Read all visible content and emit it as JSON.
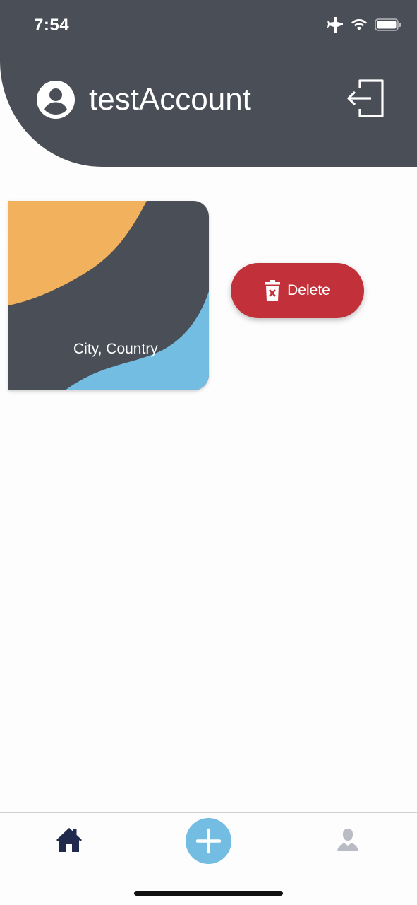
{
  "status_bar": {
    "time": "7:54",
    "icons": [
      "airplane-icon",
      "wifi-icon",
      "battery-icon"
    ]
  },
  "header": {
    "account_name": "testAccount",
    "avatar_icon": "account-circle-icon",
    "logout_icon": "logout-icon"
  },
  "card": {
    "location": "City, Country",
    "colors": {
      "background": "#4a4e57",
      "orange_wave": "#f2b15c",
      "blue_wave": "#73bde3"
    }
  },
  "actions": {
    "delete_label": "Delete",
    "delete_icon": "trash-x-icon",
    "delete_color": "#c2313a"
  },
  "bottom_nav": {
    "items": [
      {
        "icon": "home-icon",
        "active": true
      },
      {
        "icon": "plus-icon",
        "color": "#73bde3"
      },
      {
        "icon": "user-icon",
        "active": false
      }
    ]
  }
}
